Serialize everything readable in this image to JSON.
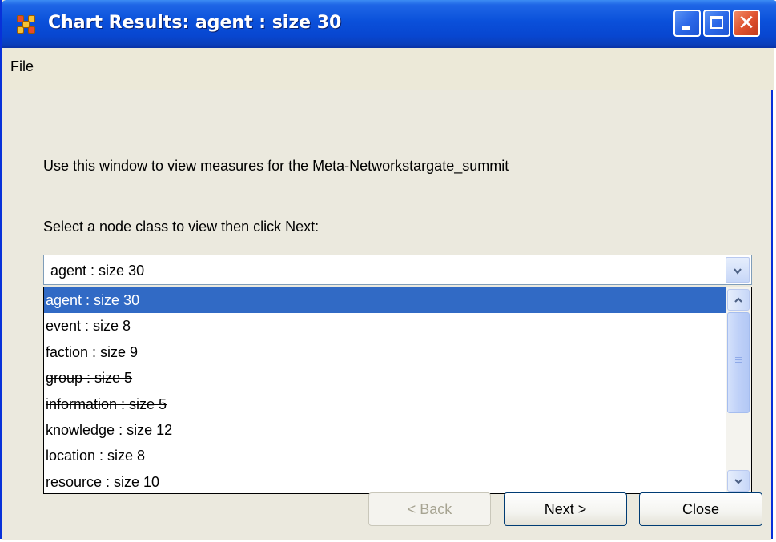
{
  "window": {
    "title": "Chart Results: agent : size 30"
  },
  "menu": {
    "file_label": "File"
  },
  "content": {
    "intro_text": "Use this window to view measures for the Meta-Networkstargate_summit",
    "prompt_text": "Select a node class to view then click Next:"
  },
  "combo": {
    "selected_value": "agent : size 30",
    "options": [
      {
        "label": "agent : size 30",
        "selected": true,
        "disabled": false
      },
      {
        "label": "event : size 8",
        "selected": false,
        "disabled": false
      },
      {
        "label": "faction : size 9",
        "selected": false,
        "disabled": false
      },
      {
        "label": "group : size 5",
        "selected": false,
        "disabled": true
      },
      {
        "label": "information : size 5",
        "selected": false,
        "disabled": true
      },
      {
        "label": "knowledge : size 12",
        "selected": false,
        "disabled": false
      },
      {
        "label": "location : size 8",
        "selected": false,
        "disabled": false
      },
      {
        "label": "resource : size 10",
        "selected": false,
        "disabled": false
      }
    ]
  },
  "buttons": {
    "back_label": "< Back",
    "next_label": "Next >",
    "close_label": "Close"
  },
  "colors": {
    "titlebar": "#0A50DA",
    "selection": "#316AC5",
    "dialog_bg": "#ECE9D8",
    "close_button": "#E0532F"
  },
  "icons": {
    "app": "network-dots-icon",
    "minimize": "minimize-icon",
    "maximize": "maximize-icon",
    "close": "close-icon",
    "combo_arrow": "chevron-down-icon",
    "scroll_up": "chevron-up-icon",
    "scroll_down": "chevron-down-icon"
  }
}
